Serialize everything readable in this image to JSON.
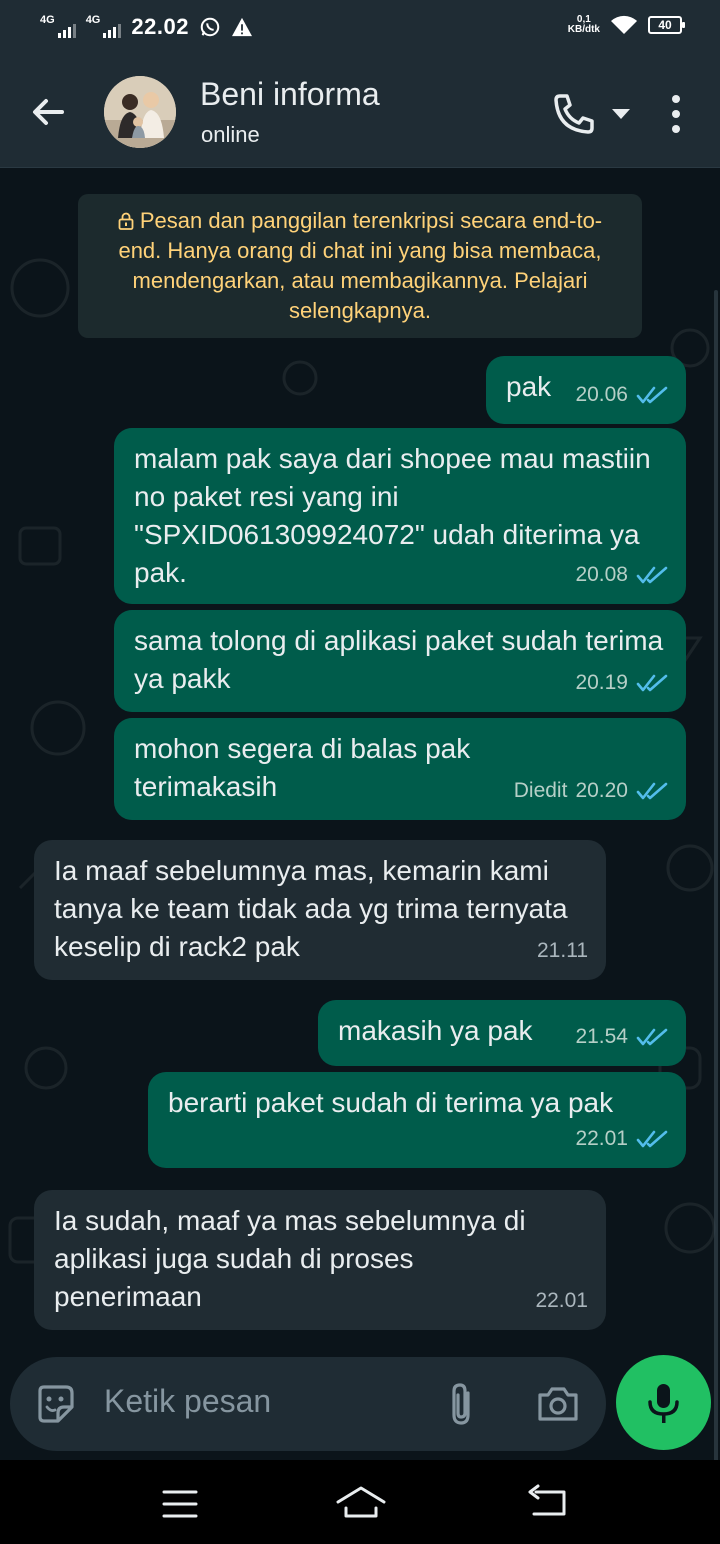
{
  "status_bar": {
    "network1": "4G",
    "network2": "4G",
    "time": "22.02",
    "speed_value": "0,1",
    "speed_unit": "KB/dtk",
    "battery": "40"
  },
  "header": {
    "contact_name": "Beni informa",
    "contact_status": "online"
  },
  "encryption_notice": "Pesan dan panggilan terenkripsi secara end-to-end. Hanya orang di chat ini yang bisa membaca, mendengarkan, atau membagikannya. Pelajari selengkapnya.",
  "messages": [
    {
      "direction": "out",
      "text": "pak",
      "time": "20.06",
      "status": "read"
    },
    {
      "direction": "out",
      "text": "malam pak saya dari shopee mau mastiin no paket resi yang ini \"SPXID061309924072\" udah diterima ya pak.",
      "time": "20.08",
      "status": "read"
    },
    {
      "direction": "out",
      "text": "sama tolong di aplikasi paket sudah terima ya pakk",
      "time": "20.19",
      "status": "read"
    },
    {
      "direction": "out",
      "text": "mohon segera di balas pak terimakasih",
      "edited": "Diedit",
      "time": "20.20",
      "status": "read"
    },
    {
      "direction": "in",
      "text": "Ia maaf sebelumnya mas, kemarin kami tanya ke team tidak ada yg trima ternyata keselip di rack2 pak",
      "time": "21.11"
    },
    {
      "direction": "out",
      "text": "makasih ya pak",
      "time": "21.54",
      "status": "read"
    },
    {
      "direction": "out",
      "text": "berarti paket sudah di terima ya pak",
      "time": "22.01",
      "status": "read"
    },
    {
      "direction": "in",
      "text": "Ia sudah, maaf ya mas sebelumnya di aplikasi juga sudah di proses penerimaan",
      "time": "22.01"
    }
  ],
  "composer": {
    "placeholder": "Ketik pesan"
  },
  "colors": {
    "outgoing_bubble": "#005c4b",
    "incoming_bubble": "#202c33",
    "read_ticks": "#53bdeb",
    "mic_button": "#21c063",
    "encryption_text": "#ffd279"
  },
  "icons": [
    "back-arrow-icon",
    "phone-icon",
    "caret-down-icon",
    "more-vertical-icon",
    "lock-icon",
    "double-check-icon",
    "emoji-icon",
    "paperclip-icon",
    "camera-icon",
    "mic-icon",
    "nav-menu-icon",
    "nav-home-icon",
    "nav-back-icon"
  ]
}
